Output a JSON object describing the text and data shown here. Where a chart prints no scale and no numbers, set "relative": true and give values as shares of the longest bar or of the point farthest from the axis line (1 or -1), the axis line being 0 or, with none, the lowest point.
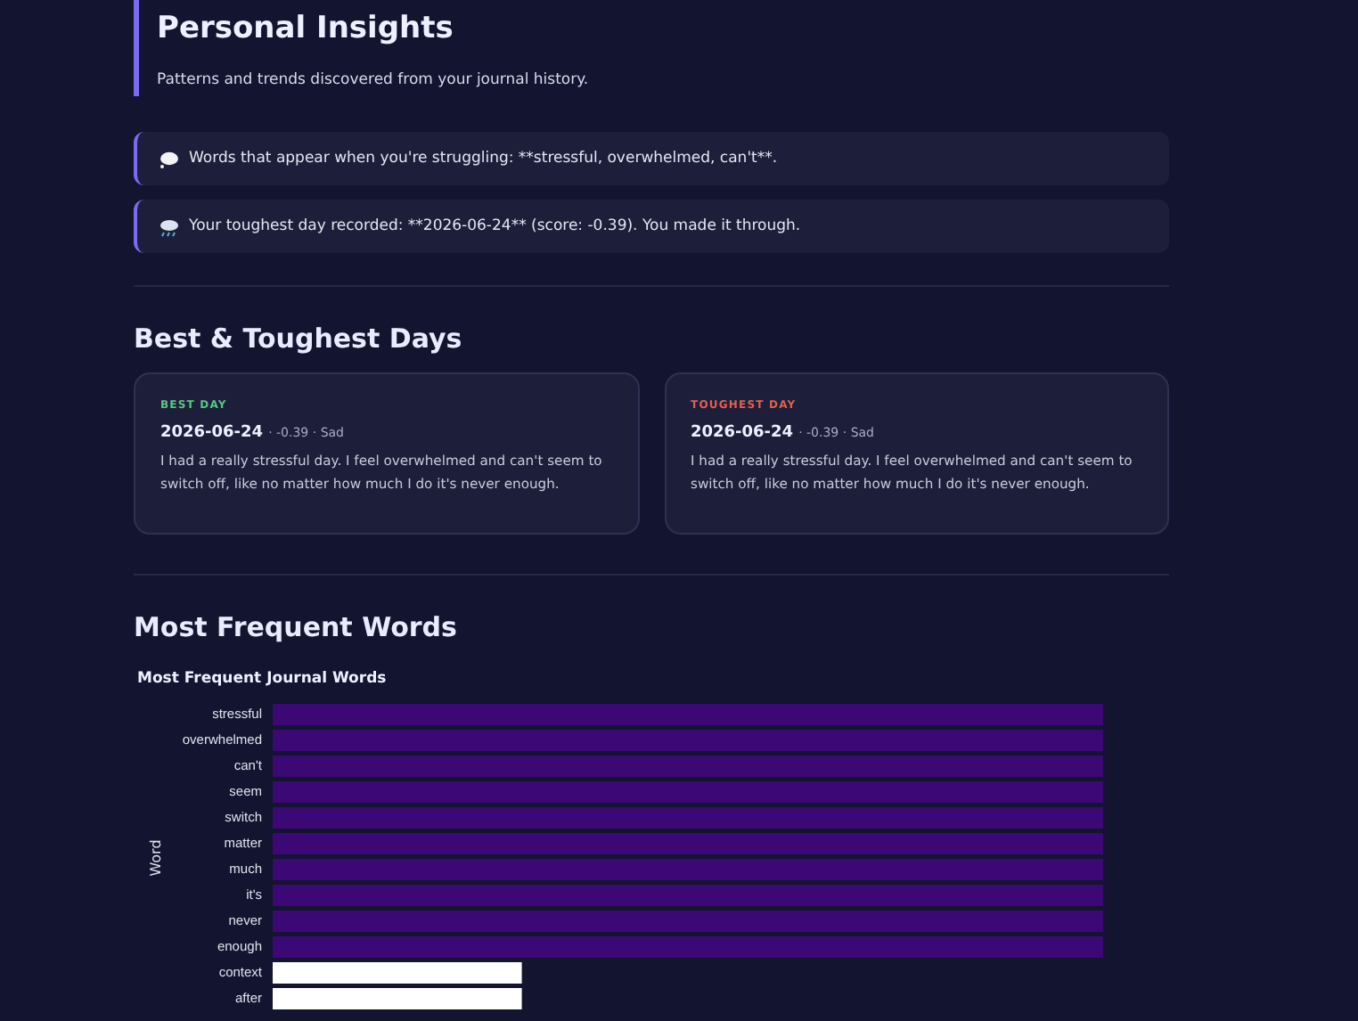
{
  "header": {
    "title": "Personal Insights",
    "subtitle": "Patterns and trends discovered from your journal history."
  },
  "insights": [
    {
      "kind": "words",
      "text": "Words that appear when you're struggling: **stressful, overwhelmed, can't**."
    },
    {
      "kind": "toughest",
      "text": "Your toughest day recorded: **2026-06-24** (score: -0.39). You made it through."
    }
  ],
  "days_section": {
    "title": "Best & Toughest Days",
    "cards": [
      {
        "kind": "best",
        "label": "BEST DAY",
        "date": "2026-06-24",
        "meta": "· -0.39 · Sad",
        "text": "I had a really stressful day. I feel overwhelmed and can't seem to switch off, like no matter how much I do it's never enough."
      },
      {
        "kind": "toughest",
        "label": "TOUGHEST DAY",
        "date": "2026-06-24",
        "meta": "· -0.39 · Sad",
        "text": "I had a really stressful day. I feel overwhelmed and can't seem to switch off, like no matter how much I do it's never enough."
      }
    ]
  },
  "words_section": {
    "title": "Most Frequent Words",
    "chart_data": {
      "type": "bar",
      "orientation": "horizontal",
      "title": "Most Frequent Journal Words",
      "ylabel": "Word",
      "categories": [
        "stressful",
        "overwhelmed",
        "can't",
        "seem",
        "switch",
        "matter",
        "much",
        "it's",
        "never",
        "enough",
        "context",
        "after"
      ],
      "values": [
        1,
        1,
        1,
        1,
        1,
        1,
        1,
        1,
        1,
        1,
        0.3,
        0.3
      ],
      "relative": true
    }
  }
}
